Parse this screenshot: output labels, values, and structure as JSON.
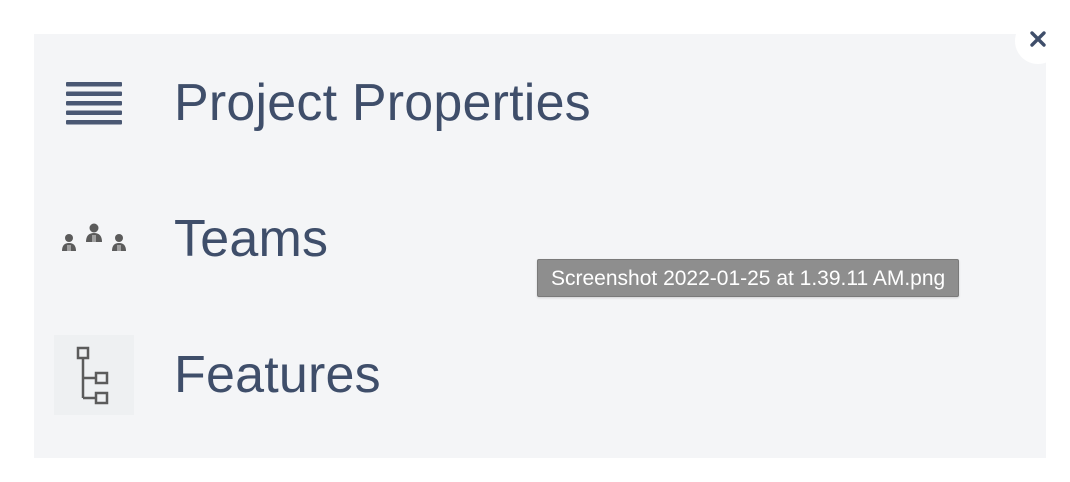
{
  "menu": {
    "items": [
      {
        "label": "Project Properties",
        "icon": "list-icon"
      },
      {
        "label": "Teams",
        "icon": "teams-icon"
      },
      {
        "label": "Features",
        "icon": "hierarchy-icon"
      }
    ]
  },
  "close_button": {
    "icon": "close-icon"
  },
  "tooltip": {
    "text": "Screenshot 2022-01-25 at 1.39.11 AM.png"
  },
  "colors": {
    "panel_background": "#f4f5f7",
    "label_text": "#3f4e6a",
    "icon_color": "#4a5873",
    "tooltip_background": "#8e8e8e"
  }
}
